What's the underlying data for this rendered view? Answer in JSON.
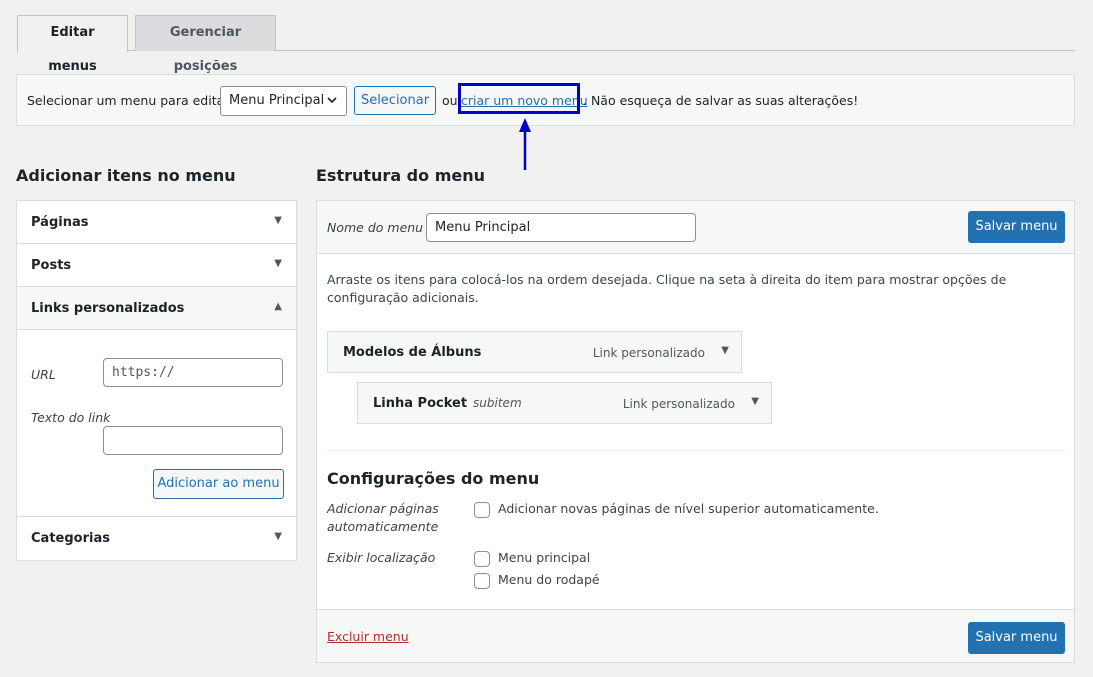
{
  "tabs": {
    "edit": "Editar menus",
    "manage": "Gerenciar posições"
  },
  "select_bar": {
    "label": "Selecionar um menu para editar:",
    "selected_menu": "Menu Principal",
    "select_button": "Selecionar",
    "or_text": "ou",
    "create_link": "criar um novo menu",
    "note": ". Não esqueça de salvar as suas alterações!"
  },
  "left": {
    "heading": "Adicionar itens no menu",
    "panels": [
      {
        "title": "Páginas"
      },
      {
        "title": "Posts"
      },
      {
        "title": "Links personalizados"
      },
      {
        "title": "Categorias"
      }
    ],
    "custom_links": {
      "url_label": "URL",
      "url_placeholder": "https://",
      "text_label": "Texto do link",
      "add_button": "Adicionar ao menu"
    }
  },
  "right": {
    "heading": "Estrutura do menu",
    "name_label": "Nome do menu",
    "name_value": "Menu Principal",
    "save_button": "Salvar menu",
    "instructions": "Arraste os itens para colocá-los na ordem desejada. Clique na seta à direita do item para mostrar opções de configuração adicionais.",
    "items": [
      {
        "name": "Modelos de Álbuns",
        "sub": "",
        "type": "Link personalizado"
      },
      {
        "name": "Linha Pocket",
        "sub": "subitem",
        "type": "Link personalizado"
      }
    ],
    "settings": {
      "heading": "Configurações do menu",
      "auto_add_label": "Adicionar páginas automaticamente",
      "auto_add_option": "Adicionar novas páginas de nível superior automaticamente.",
      "location_label": "Exibir localização",
      "locations": [
        "Menu principal",
        "Menu do rodapé"
      ]
    },
    "delete_link": "Excluir menu"
  },
  "colors": {
    "primary": "#2271b1",
    "highlight": "#0000c8",
    "danger": "#b32d2e"
  },
  "icons": {
    "dropdown": "chevron-down-icon",
    "collapsed": "triangle-down-icon",
    "expanded": "triangle-up-icon",
    "annotation": "arrow-up-icon"
  }
}
